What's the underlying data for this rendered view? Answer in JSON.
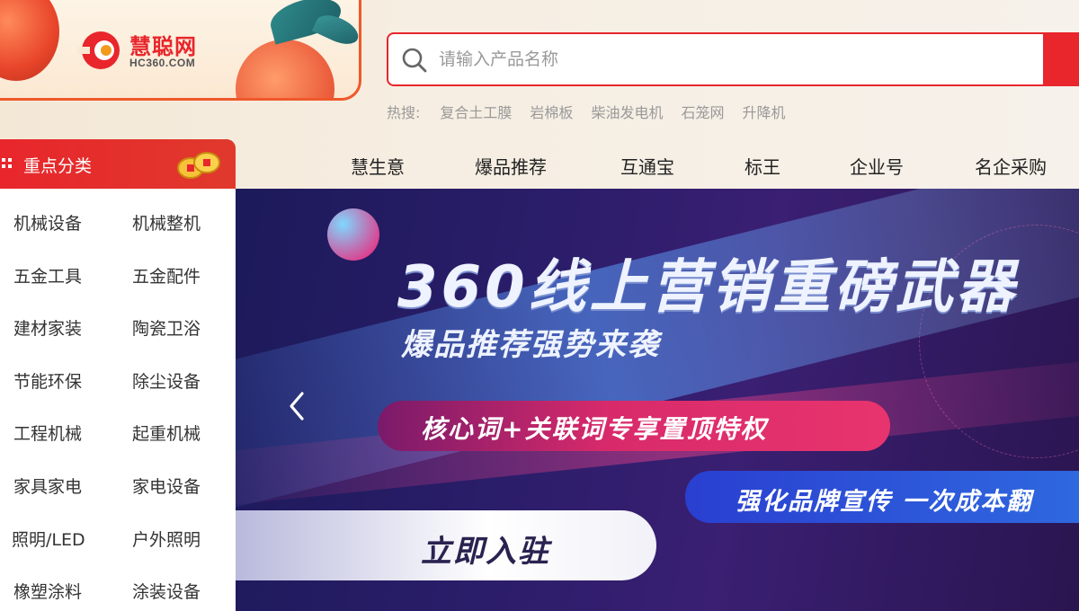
{
  "logo": {
    "cn": "慧聪网",
    "en": "HC360.COM"
  },
  "search": {
    "placeholder": "请输入产品名称",
    "value": ""
  },
  "hotwords": {
    "label": "热搜:",
    "items": [
      "复合土工膜",
      "岩棉板",
      "柴油发电机",
      "石笼网",
      "升降机"
    ]
  },
  "nav": {
    "items": [
      "慧生意",
      "爆品推荐",
      "互通宝",
      "标王",
      "企业号",
      "名企采购"
    ]
  },
  "sidebar": {
    "title": "重点分类",
    "categories": [
      [
        "机械设备",
        "机械整机"
      ],
      [
        "五金工具",
        "五金配件"
      ],
      [
        "建材家装",
        "陶瓷卫浴"
      ],
      [
        "节能环保",
        "除尘设备"
      ],
      [
        "工程机械",
        "起重机械"
      ],
      [
        "家具家电",
        "家电设备"
      ],
      [
        "照明/LED",
        "户外照明"
      ],
      [
        "橡塑涂料",
        "涂装设备"
      ]
    ]
  },
  "banner": {
    "headline": "360线上营销重磅武器",
    "subhead": "爆品推荐强势来袭",
    "pill_red": "核心词+关联词专享置顶特权",
    "pill_blue": "强化品牌宣传 一次成本翻",
    "cta": "立即入驻"
  },
  "colors": {
    "brand_red": "#e8262c",
    "banner_bg": "#2b1d6a",
    "accent_orange": "#f0582a"
  },
  "icons": [
    "search-icon",
    "grid-icon",
    "coin-icon",
    "chevron-left-icon",
    "logo-mark-icon"
  ]
}
